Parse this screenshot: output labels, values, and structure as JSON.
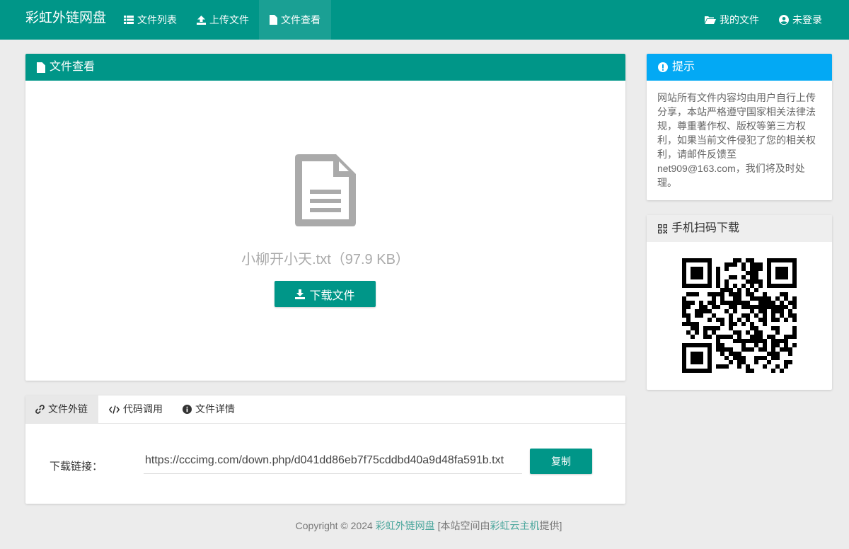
{
  "nav": {
    "brand": "彩虹外链网盘",
    "items": [
      {
        "label": "文件列表",
        "icon": "list-icon"
      },
      {
        "label": "上传文件",
        "icon": "upload-icon"
      },
      {
        "label": "文件查看",
        "icon": "file-icon"
      }
    ],
    "right_items": [
      {
        "label": "我的文件",
        "icon": "folder-open-icon"
      },
      {
        "label": "未登录",
        "icon": "user-circle-icon"
      }
    ],
    "active": "文件查看"
  },
  "file_panel": {
    "title": "文件查看",
    "file_name": "小柳开小天.txt（97.9 KB）",
    "download_label": "下载文件"
  },
  "tabs": {
    "items": [
      {
        "label": "文件外链",
        "icon": "link-icon"
      },
      {
        "label": "代码调用",
        "icon": "code-icon"
      },
      {
        "label": "文件详情",
        "icon": "info-icon"
      }
    ],
    "active": "文件外链"
  },
  "link_section": {
    "label": "下载链接：",
    "url": "https://cccimg.com/down.php/d041dd86eb7f75cddbd40a9d48fa591b.txt",
    "copy_label": "复制"
  },
  "notice": {
    "title": "提示",
    "text": "网站所有文件内容均由用户自行上传分享，本站严格遵守国家相关法律法规，尊重著作权、版权等第三方权利，如果当前文件侵犯了您的相关权利，请邮件反馈至net909@163.com，我们将及时处理。"
  },
  "qr_panel": {
    "title": "手机扫码下载"
  },
  "footer": {
    "copyright": "Copyright © 2024 ",
    "site_link": "彩虹外链网盘",
    "mid": " [本站空间由",
    "host_link": "彩虹云主机",
    "end": "提供]"
  },
  "colors": {
    "primary": "#009688",
    "nav_active": "#1aa094",
    "notice_header": "#03a9f4",
    "background": "#ececec"
  }
}
